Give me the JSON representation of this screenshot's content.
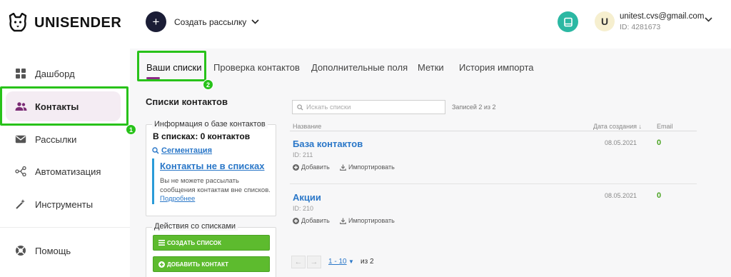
{
  "brand": {
    "name": "UNISENDER"
  },
  "topbar": {
    "create_label": "Создать рассылку",
    "user_initial": "U",
    "user_email": "unitest.cvs@gmail.com",
    "user_id": "ID: 4281673"
  },
  "sidebar": {
    "items": [
      {
        "label": "Дашборд",
        "icon": "dashboard-icon"
      },
      {
        "label": "Контакты",
        "icon": "people-icon",
        "active": true
      },
      {
        "label": "Рассылки",
        "icon": "mail-icon"
      },
      {
        "label": "Автоматизация",
        "icon": "automation-icon"
      },
      {
        "label": "Инструменты",
        "icon": "magic-wand-icon"
      },
      {
        "label": "Помощь",
        "icon": "help-lifebuoy-icon"
      }
    ]
  },
  "tabs": [
    {
      "label": "Ваши списки",
      "active": true
    },
    {
      "label": "Проверка контактов"
    },
    {
      "label": "Дополнительные поля"
    },
    {
      "label": "Метки"
    },
    {
      "label": "История импорта"
    }
  ],
  "panel": {
    "title": "Списки контактов",
    "info_legend": "Информация о базе контактов",
    "info_count": "В списках: 0 контактов",
    "segmentation": "Сегментация",
    "not_in_lists_title": "Контакты не в списках",
    "not_in_lists_text": "Вы не можете рассылать сообщения контактам вне списков.",
    "more_link": "Подробнее",
    "actions_legend": "Действия со списками",
    "create_list": "СОЗДАТЬ СПИСОК",
    "add_contact": "ДОБАВИТЬ КОНТАКТ"
  },
  "table": {
    "search_placeholder": "Искать списки",
    "records": "Записей 2 из 2",
    "columns": {
      "name": "Название",
      "date": "Дата создания ↓",
      "email": "Email"
    },
    "rows": [
      {
        "name": "База контактов",
        "id": "ID: 211",
        "date": "08.05.2021",
        "email": "0"
      },
      {
        "name": "Акции",
        "id": "ID: 210",
        "date": "08.05.2021",
        "email": "0"
      }
    ],
    "row_actions": {
      "add": "Добавить",
      "import": "Импортировать"
    },
    "pager": {
      "range": "1 - 10",
      "of": "из 2"
    }
  },
  "annotations": {
    "badge1": "1",
    "badge2": "2"
  },
  "colors": {
    "accent_purple": "#8c2a86",
    "link_blue": "#2a77c8",
    "green": "#5dbb2e",
    "highlight": "#28c21a",
    "teal": "#2bb8a3"
  }
}
